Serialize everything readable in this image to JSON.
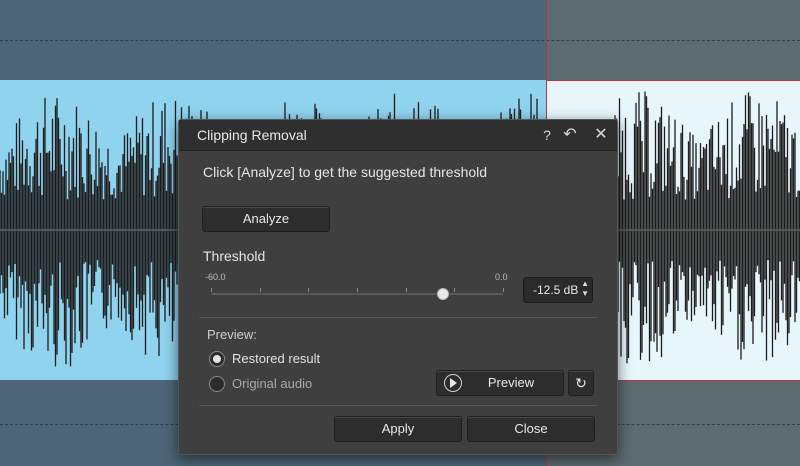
{
  "dialog": {
    "title": "Clipping Removal",
    "instruction": "Click [Analyze] to get the suggested threshold",
    "analyze_label": "Analyze",
    "threshold_label": "Threshold",
    "slider": {
      "min_label": "-60.0",
      "max_label": "0.0",
      "min": -60,
      "max": 0,
      "value": -12.5
    },
    "db_value": "-12.5 dB",
    "preview_label": "Preview:",
    "radio_options": [
      {
        "label": "Restored result",
        "selected": true
      },
      {
        "label": "Original audio",
        "selected": false
      }
    ],
    "preview_button": "Preview",
    "apply_label": "Apply",
    "close_label": "Close"
  },
  "icons": {
    "help": "?",
    "undo": "↶",
    "close": "✕",
    "reset": "↻",
    "up": "▲",
    "down": "▼"
  },
  "colors": {
    "waveform_bg_unselected": "#8fd3ef",
    "waveform_bg_selected": "#e6f6fb",
    "selection_line": "#c0333a",
    "dialog_bg": "#3f3f3f"
  }
}
